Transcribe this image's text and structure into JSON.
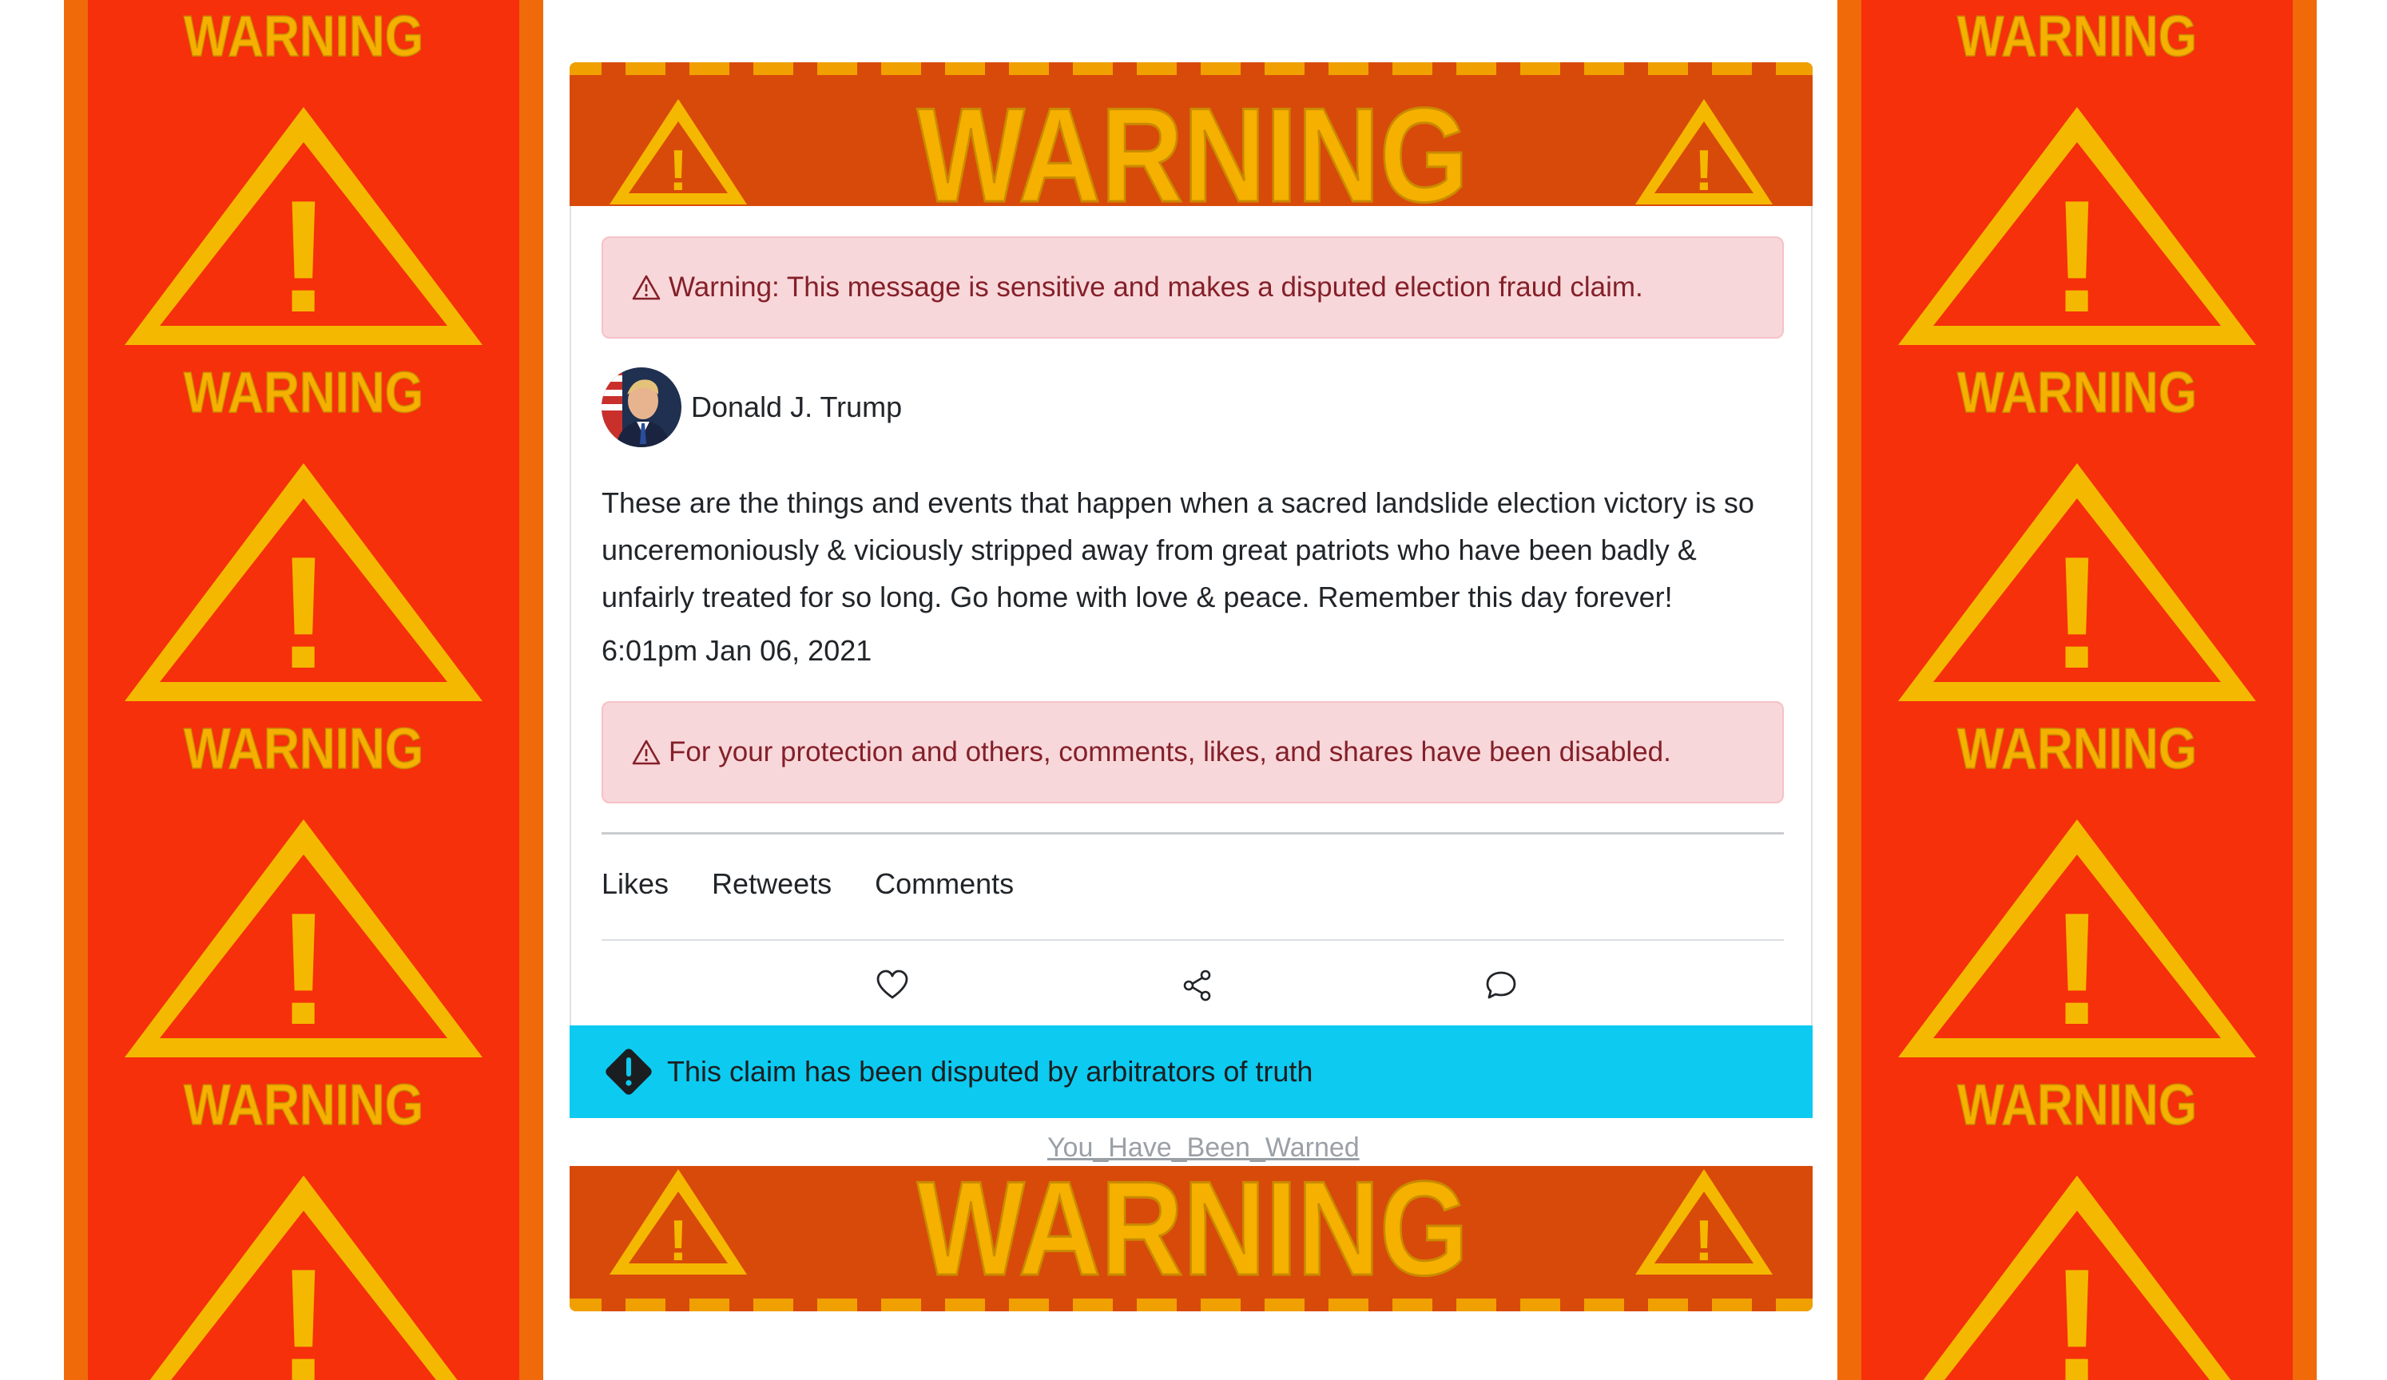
{
  "side_banners": {
    "repeated_text": "WARNING",
    "exclamation": "!"
  },
  "top_banner": {
    "text": "WARNING",
    "exclamation": "!"
  },
  "bottom_banner": {
    "text": "WARNING",
    "exclamation": "!"
  },
  "alerts": {
    "sensitive": "Warning: This message is sensitive and makes a disputed election fraud claim.",
    "disabled": "For your protection and others, comments, likes, and shares have been disabled."
  },
  "post": {
    "author": "Donald J. Trump",
    "body": "These are the things and events that happen when a sacred landslide election victory is so unceremoniously & viciously stripped away from great patriots who have been badly & unfairly treated for so long. Go home with love & peace. Remember this day forever!",
    "timestamp": "6:01pm Jan 06, 2021"
  },
  "stats": {
    "likes": "Likes",
    "retweets": "Retweets",
    "comments": "Comments"
  },
  "actions": {
    "like_icon": "heart-icon",
    "share_icon": "share-icon",
    "comment_icon": "speech-bubble-icon"
  },
  "dispute": {
    "text": "This claim has been disputed by arbitrators of truth"
  },
  "footer_link": "You_Have_Been_Warned",
  "colors": {
    "banner_orange": "#f06a0a",
    "banner_red": "#f5300a",
    "banner_dark": "#d84a0a",
    "warning_yellow": "#f5b800",
    "alert_bg": "#f8d7da",
    "alert_text": "#842029",
    "info_bar": "#0dcaf0"
  }
}
